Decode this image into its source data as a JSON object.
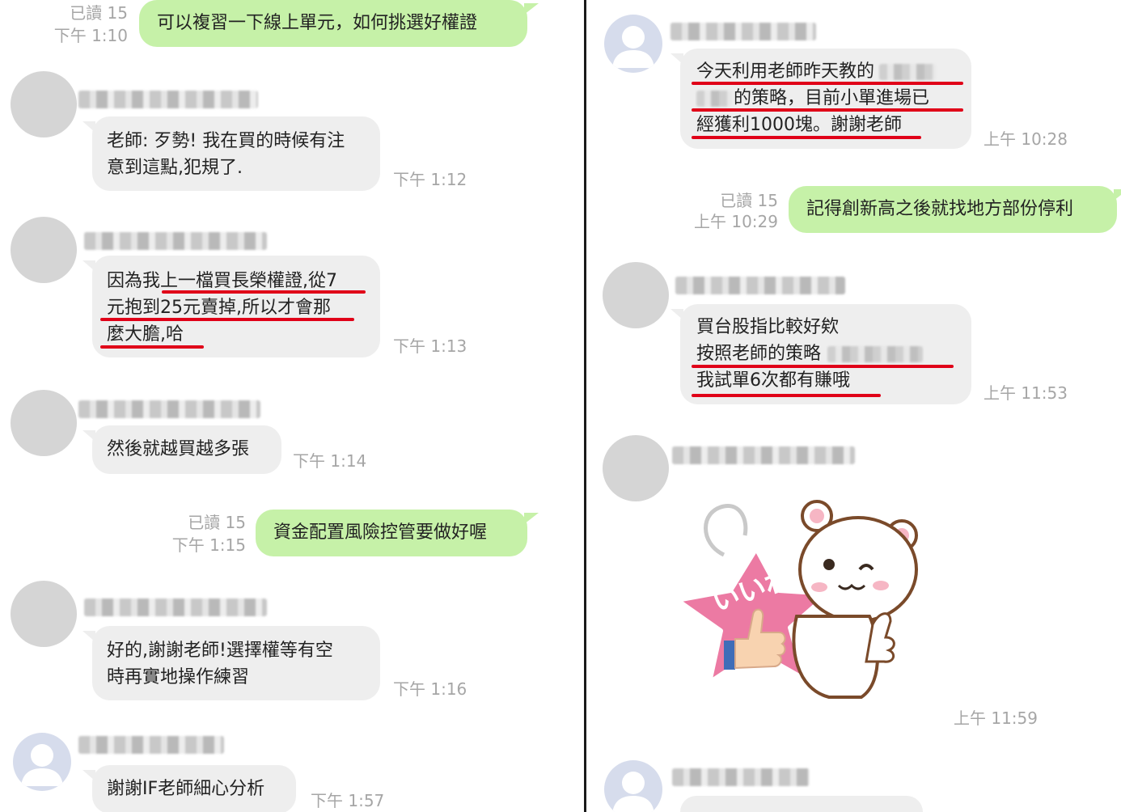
{
  "left": {
    "messages": [
      {
        "id": "l1",
        "dir": "out",
        "read": "已讀 15",
        "time": "下午 1:10",
        "lines": [
          "可以複習一下線上單元，如何挑選好權證"
        ]
      },
      {
        "id": "l2",
        "dir": "in",
        "time": "下午 1:12",
        "lines": [
          "老師: 歹勢! 我在買的時候有注",
          "意到這點,犯規了."
        ]
      },
      {
        "id": "l3",
        "dir": "in",
        "time": "下午 1:13",
        "lines": [
          "因為我上一檔買長榮權證,從7",
          "元抱到25元賣掉,所以才會那",
          "麼大膽,哈"
        ]
      },
      {
        "id": "l4",
        "dir": "in",
        "time": "下午 1:14",
        "lines": [
          "然後就越買越多張"
        ]
      },
      {
        "id": "l5",
        "dir": "out",
        "read": "已讀 15",
        "time": "下午 1:15",
        "lines": [
          "資金配置風險控管要做好喔"
        ]
      },
      {
        "id": "l6",
        "dir": "in",
        "time": "下午 1:16",
        "lines": [
          "好的,謝謝老師!選擇權等有空",
          "時再實地操作練習"
        ]
      },
      {
        "id": "l7",
        "dir": "in",
        "time": "下午 1:57",
        "lines": [
          "謝謝IF老師細心分析"
        ]
      }
    ]
  },
  "right": {
    "messages": [
      {
        "id": "r1",
        "dir": "in",
        "time": "上午 10:28",
        "lines": [
          "今天利用老師昨天教的",
          "的策略，目前小單進場已",
          "經獲利1000塊。謝謝老師"
        ]
      },
      {
        "id": "r2",
        "dir": "out",
        "read": "已讀 15",
        "time": "上午 10:29",
        "lines": [
          "記得創新高之後就找地方部份停利"
        ]
      },
      {
        "id": "r3",
        "dir": "in",
        "time": "上午 11:53",
        "lines": [
          "買台股指比較好欸",
          "按照老師的策略",
          "我試單6次都有賺哦"
        ]
      },
      {
        "id": "r4",
        "dir": "in",
        "time": "上午 11:59",
        "sticker": {
          "icon": "bear-thumbs-up-sticker",
          "text": "いいね"
        }
      }
    ]
  },
  "colors": {
    "outgoing_bubble": "#c6f1a8",
    "incoming_bubble": "#eeeeee",
    "underline": "#e00018",
    "meta": "#a6a6a6",
    "avatar": "#d5d5d5"
  }
}
